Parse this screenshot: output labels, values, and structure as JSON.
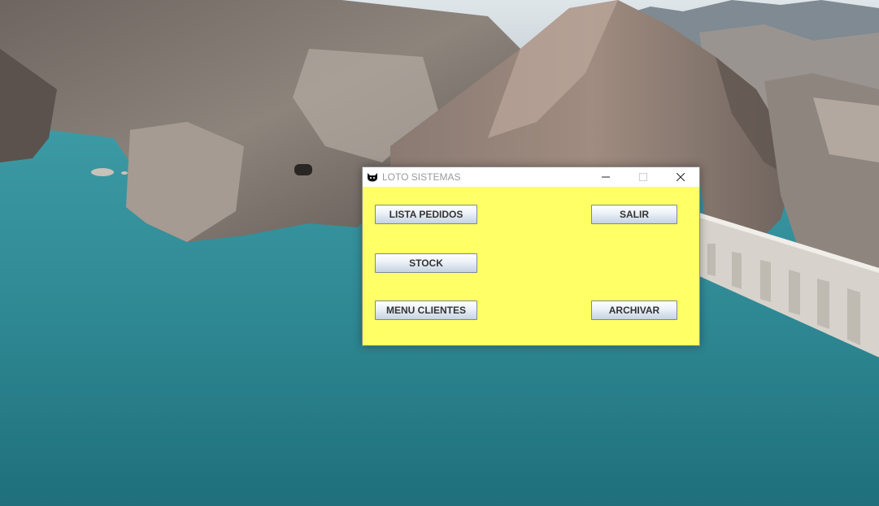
{
  "window": {
    "title": "LOTO SISTEMAS",
    "app_icon": "cat-icon",
    "background_color": "#ffff66",
    "controls": {
      "minimize_icon": "minimize-icon",
      "maximize_icon": "maximize-icon",
      "close_icon": "close-icon"
    }
  },
  "buttons": {
    "lista_pedidos": "LISTA PEDIDOS",
    "stock": "STOCK",
    "menu_clientes": "MENU CLIENTES",
    "salir": "SALIR",
    "archivar": "ARCHIVAR"
  },
  "desktop": {
    "wallpaper": "lake-and-mountains-with-dam"
  }
}
